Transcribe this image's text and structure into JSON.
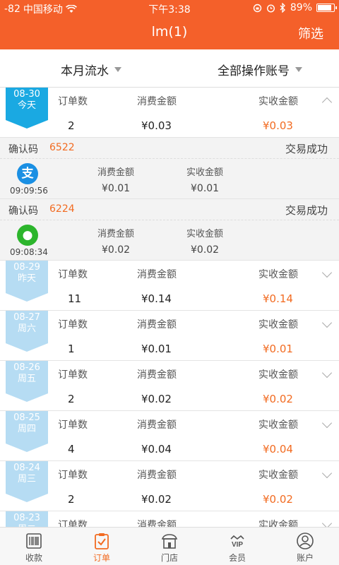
{
  "status_bar": {
    "signal": "-82",
    "carrier": "中国移动",
    "time": "下午3:38",
    "battery": "89%",
    "battery_level": 0.89
  },
  "nav": {
    "title": "lm(1)",
    "filter_label": "筛选"
  },
  "filters": {
    "period": "本月流水",
    "account": "全部操作账号"
  },
  "columns": {
    "orders": "订单数",
    "consume": "消费金额",
    "received": "实收金额"
  },
  "days": [
    {
      "date": "08-30",
      "weekday": "今天",
      "orders": "2",
      "consume": "¥0.03",
      "received": "¥0.03",
      "expanded": true,
      "transactions": [
        {
          "label": "确认码",
          "code": "6522",
          "status": "交易成功",
          "method": "alipay",
          "icon_glyph": "支",
          "time": "09:09:56",
          "consume_label": "消费金额",
          "consume": "¥0.01",
          "received_label": "实收金额",
          "received": "¥0.01"
        },
        {
          "label": "确认码",
          "code": "6224",
          "status": "交易成功",
          "method": "wechat",
          "icon_glyph": "●",
          "time": "09:08:34",
          "consume_label": "消费金额",
          "consume": "¥0.02",
          "received_label": "实收金额",
          "received": "¥0.02"
        }
      ]
    },
    {
      "date": "08-29",
      "weekday": "昨天",
      "orders": "11",
      "consume": "¥0.14",
      "received": "¥0.14",
      "expanded": false
    },
    {
      "date": "08-27",
      "weekday": "周六",
      "orders": "1",
      "consume": "¥0.01",
      "received": "¥0.01",
      "expanded": false
    },
    {
      "date": "08-26",
      "weekday": "周五",
      "orders": "2",
      "consume": "¥0.02",
      "received": "¥0.02",
      "expanded": false
    },
    {
      "date": "08-25",
      "weekday": "周四",
      "orders": "4",
      "consume": "¥0.04",
      "received": "¥0.04",
      "expanded": false
    },
    {
      "date": "08-24",
      "weekday": "周三",
      "orders": "2",
      "consume": "¥0.02",
      "received": "¥0.02",
      "expanded": false
    },
    {
      "date": "08-23",
      "weekday": "周二",
      "orders": "",
      "consume": "",
      "received": "",
      "expanded": false
    }
  ],
  "tabs": [
    {
      "label": "收款",
      "icon": "barcode-icon",
      "active": false
    },
    {
      "label": "订单",
      "icon": "clipboard-check-icon",
      "active": true
    },
    {
      "label": "门店",
      "icon": "store-icon",
      "active": false
    },
    {
      "label": "会员",
      "icon": "vip-crown-icon",
      "active": false
    },
    {
      "label": "账户",
      "icon": "user-circle-icon",
      "active": false
    }
  ],
  "colors": {
    "brand": "#f4602a",
    "accent_orange": "#f26b21",
    "tag_active": "#1aa9e2",
    "tag_inactive": "#b6dcf3",
    "alipay": "#1a8fe3",
    "wechat": "#2cb52c"
  }
}
